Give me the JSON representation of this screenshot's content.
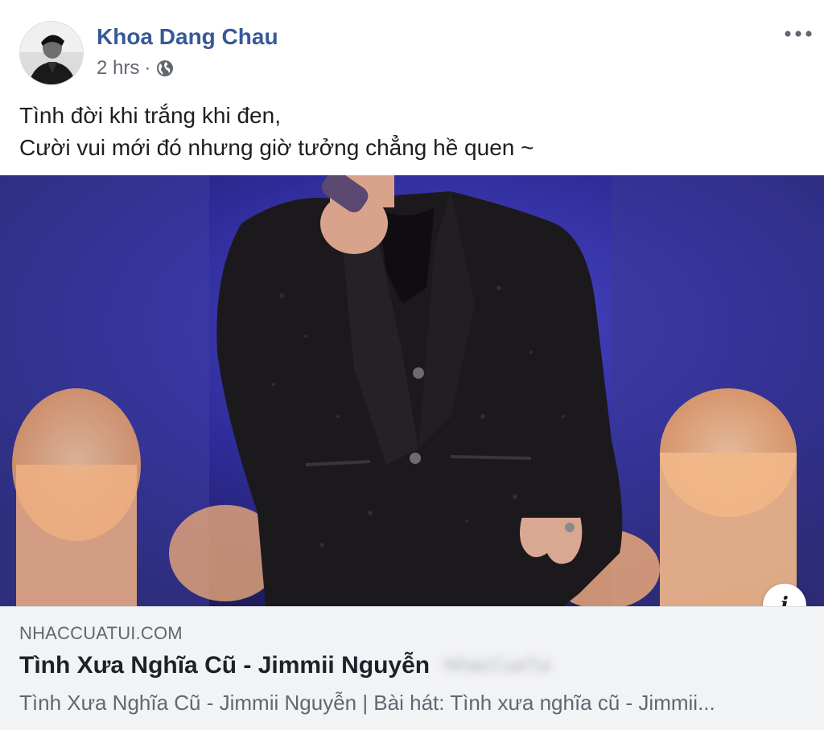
{
  "post": {
    "author": "Khoa Dang Chau",
    "time": "2 hrs",
    "separator": "·",
    "privacy_icon": "globe-icon",
    "more_icon": "more-dots-icon",
    "text_lines": [
      "Tình đời khi trắng khi đen,",
      "Cười vui mới đó nhưng giờ tưởng chẳng hề quen ~"
    ]
  },
  "link_preview": {
    "domain": "NHACCUATUI.COM",
    "title": "Tình Xưa Nghĩa Cũ - Jimmii Nguyễn",
    "title_suffix": "NhacCuaTui",
    "description": "Tình Xưa Nghĩa Cũ - Jimmii Nguyễn | Bài hát: Tình xưa nghĩa cũ - Jimmii...",
    "info_label": "i"
  },
  "colors": {
    "author": "#385898",
    "meta": "#606770",
    "stage_background": "#2b2a86",
    "link_box_bg": "#f2f3f5"
  }
}
